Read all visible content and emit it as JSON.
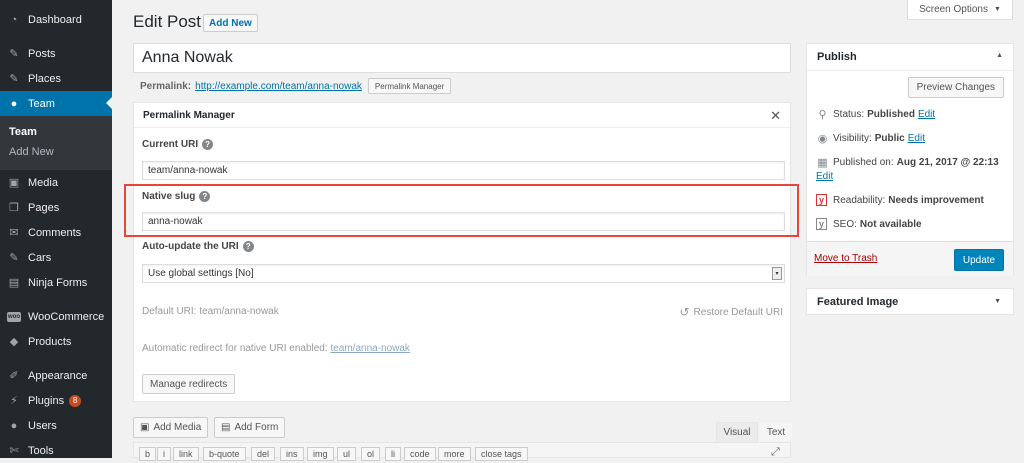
{
  "sidebar": {
    "items": [
      {
        "label": "Dashboard",
        "icon": "dashboard-icon",
        "glyph": "◔"
      },
      {
        "label": "Posts",
        "icon": "pin-icon",
        "glyph": "✎"
      },
      {
        "label": "Places",
        "icon": "pin-icon",
        "glyph": "✎"
      },
      {
        "label": "Team",
        "icon": "user-icon",
        "glyph": "●"
      },
      {
        "label": "Media",
        "icon": "media-icon",
        "glyph": "▣"
      },
      {
        "label": "Pages",
        "icon": "pages-icon",
        "glyph": "❐"
      },
      {
        "label": "Comments",
        "icon": "comments-icon",
        "glyph": "✉"
      },
      {
        "label": "Cars",
        "icon": "pin-icon",
        "glyph": "✎"
      },
      {
        "label": "Ninja Forms",
        "icon": "forms-icon",
        "glyph": "▤"
      },
      {
        "label": "WooCommerce",
        "icon": "woo-icon",
        "glyph": "woo"
      },
      {
        "label": "Products",
        "icon": "products-icon",
        "glyph": "◆"
      },
      {
        "label": "Appearance",
        "icon": "brush-icon",
        "glyph": "✐"
      },
      {
        "label": "Plugins",
        "icon": "plugin-icon",
        "glyph": "⚡",
        "badge": "8"
      },
      {
        "label": "Users",
        "icon": "users-icon",
        "glyph": "●"
      },
      {
        "label": "Tools",
        "icon": "wrench-icon",
        "glyph": "✄"
      }
    ],
    "submenu": [
      "Team",
      "Add New"
    ]
  },
  "header": {
    "title": "Edit Post",
    "add_new": "Add New",
    "screen_options": "Screen Options",
    "screen_options_arrow": "▼"
  },
  "post": {
    "title": "Anna Nowak",
    "permalink_label": "Permalink:",
    "permalink_url": "http://example.com/team/anna-nowak",
    "permalink_manager_btn": "Permalink Manager"
  },
  "pm": {
    "title": "Permalink Manager",
    "close": "✕",
    "current_uri_label": "Current URI",
    "current_uri": "team/anna-nowak",
    "native_slug_label": "Native slug",
    "native_slug": "anna-nowak",
    "auto_update_label": "Auto-update the URI",
    "auto_update_value": "Use global settings [No]",
    "default_uri_label": "Default URI:",
    "default_uri_value": "team/anna-nowak",
    "restore_label": "Restore Default URI",
    "redirect_label": "Automatic redirect for native URI enabled:",
    "redirect_value": "team/anna-nowak",
    "manage_redirects": "Manage redirects",
    "help": "?"
  },
  "editor": {
    "add_media": "Add Media",
    "add_form": "Add Form",
    "tab_visual": "Visual",
    "tab_text": "Text",
    "quicktags": [
      "b",
      "i",
      "link",
      "b-quote",
      "del",
      "ins",
      "img",
      "ul",
      "ol",
      "li",
      "code",
      "more",
      "close tags"
    ]
  },
  "publish": {
    "title": "Publish",
    "preview": "Preview Changes",
    "status_label": "Status:",
    "status_value": "Published",
    "visibility_label": "Visibility:",
    "visibility_value": "Public",
    "published_on_label": "Published on:",
    "published_on_value": "Aug 21, 2017 @ 22:13",
    "edit": "Edit",
    "readability_label": "Readability:",
    "readability_value": "Needs improvement",
    "seo_label": "SEO:",
    "seo_value": "Not available",
    "trash": "Move to Trash",
    "update": "Update"
  },
  "featured": {
    "title": "Featured Image"
  },
  "colors": {
    "sidebar_bg": "#23282d",
    "accent": "#0073aa",
    "highlight": "#e8453c",
    "badge": "#ca4a1f"
  }
}
